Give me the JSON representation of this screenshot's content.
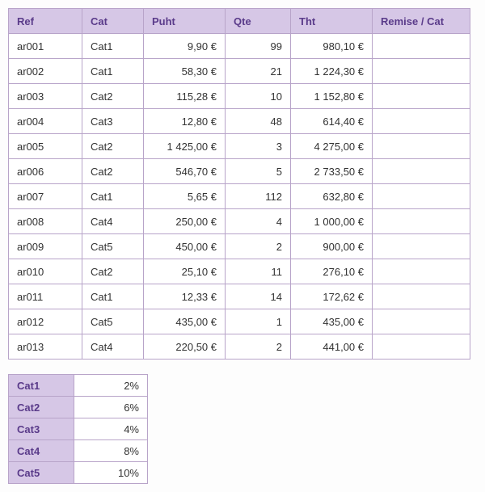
{
  "main_table": {
    "headers": {
      "ref": "Ref",
      "cat": "Cat",
      "puht": "Puht",
      "qte": "Qte",
      "tht": "Tht",
      "remise": "Remise / Cat"
    },
    "rows": [
      {
        "ref": "ar001",
        "cat": "Cat1",
        "puht": "9,90 €",
        "qte": "99",
        "tht": "980,10 €",
        "remise": ""
      },
      {
        "ref": "ar002",
        "cat": "Cat1",
        "puht": "58,30 €",
        "qte": "21",
        "tht": "1 224,30 €",
        "remise": ""
      },
      {
        "ref": "ar003",
        "cat": "Cat2",
        "puht": "115,28 €",
        "qte": "10",
        "tht": "1 152,80 €",
        "remise": ""
      },
      {
        "ref": "ar004",
        "cat": "Cat3",
        "puht": "12,80 €",
        "qte": "48",
        "tht": "614,40 €",
        "remise": ""
      },
      {
        "ref": "ar005",
        "cat": "Cat2",
        "puht": "1 425,00 €",
        "qte": "3",
        "tht": "4 275,00 €",
        "remise": ""
      },
      {
        "ref": "ar006",
        "cat": "Cat2",
        "puht": "546,70 €",
        "qte": "5",
        "tht": "2 733,50 €",
        "remise": ""
      },
      {
        "ref": "ar007",
        "cat": "Cat1",
        "puht": "5,65 €",
        "qte": "112",
        "tht": "632,80 €",
        "remise": ""
      },
      {
        "ref": "ar008",
        "cat": "Cat4",
        "puht": "250,00 €",
        "qte": "4",
        "tht": "1 000,00 €",
        "remise": ""
      },
      {
        "ref": "ar009",
        "cat": "Cat5",
        "puht": "450,00 €",
        "qte": "2",
        "tht": "900,00 €",
        "remise": ""
      },
      {
        "ref": "ar010",
        "cat": "Cat2",
        "puht": "25,10 €",
        "qte": "11",
        "tht": "276,10 €",
        "remise": ""
      },
      {
        "ref": "ar011",
        "cat": "Cat1",
        "puht": "12,33 €",
        "qte": "14",
        "tht": "172,62 €",
        "remise": ""
      },
      {
        "ref": "ar012",
        "cat": "Cat5",
        "puht": "435,00 €",
        "qte": "1",
        "tht": "435,00 €",
        "remise": ""
      },
      {
        "ref": "ar013",
        "cat": "Cat4",
        "puht": "220,50 €",
        "qte": "2",
        "tht": "441,00 €",
        "remise": ""
      }
    ]
  },
  "discount_table": {
    "rows": [
      {
        "cat": "Cat1",
        "pct": "2%"
      },
      {
        "cat": "Cat2",
        "pct": "6%"
      },
      {
        "cat": "Cat3",
        "pct": "4%"
      },
      {
        "cat": "Cat4",
        "pct": "8%"
      },
      {
        "cat": "Cat5",
        "pct": "10%"
      }
    ]
  }
}
